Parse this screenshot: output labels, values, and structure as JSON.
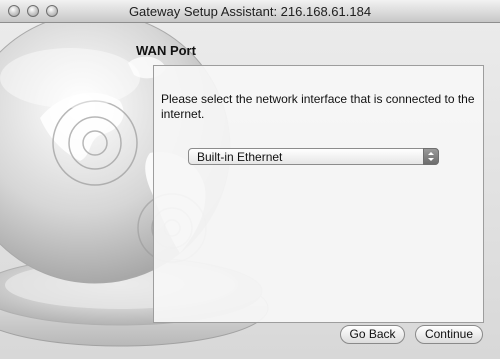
{
  "window": {
    "title": "Gateway Setup Assistant: 216.168.61.184"
  },
  "section": {
    "title": "WAN Port"
  },
  "panel": {
    "instruction": "Please select the network interface that is connected to the internet.",
    "interface_select": {
      "selected": "Built-in Ethernet"
    }
  },
  "buttons": {
    "back": "Go Back",
    "continue": "Continue"
  },
  "icons": {
    "close": "close-icon",
    "minimize": "minimize-icon",
    "zoom": "zoom-icon",
    "popup_arrows": "chevron-updown-icon",
    "decoration": "globe-icon"
  }
}
